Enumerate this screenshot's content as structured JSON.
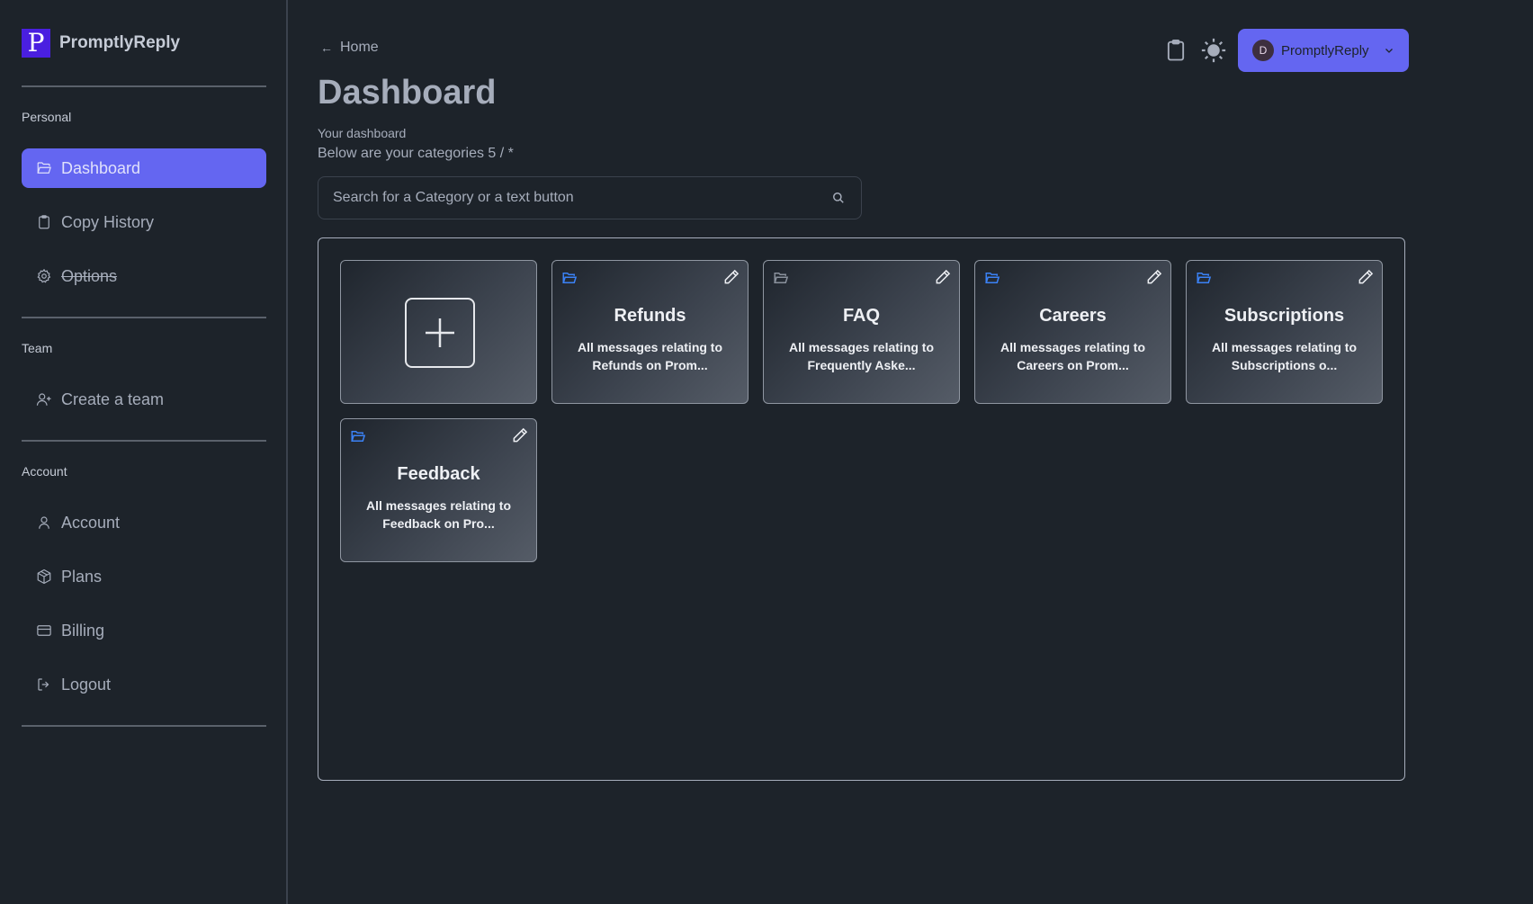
{
  "brand": {
    "logo_letter": "P",
    "name": "PromptlyReply"
  },
  "sidebar": {
    "sections": [
      {
        "label": "Personal"
      },
      {
        "label": "Team"
      },
      {
        "label": "Account"
      }
    ],
    "items": [
      {
        "label": "Dashboard",
        "icon": "folder-open-icon",
        "active": true
      },
      {
        "label": "Copy History",
        "icon": "clipboard-icon"
      },
      {
        "label": "Options",
        "icon": "gear-icon",
        "strikethrough": true
      },
      {
        "label": "Create a team",
        "icon": "user-plus-icon"
      },
      {
        "label": "Account",
        "icon": "user-icon"
      },
      {
        "label": "Plans",
        "icon": "package-icon"
      },
      {
        "label": "Billing",
        "icon": "credit-card-icon"
      },
      {
        "label": "Logout",
        "icon": "logout-icon"
      }
    ]
  },
  "header": {
    "back_label": "Home",
    "title": "Dashboard",
    "subtitle": "Your dashboard",
    "category_info": "Below are your categories 5 / *",
    "user": {
      "initial": "D",
      "name": "PromptlyReply"
    }
  },
  "search": {
    "placeholder": "Search for a Category or a text button"
  },
  "categories": [
    {
      "title": "Refunds",
      "description": "All messages relating to Refunds on Prom...",
      "folder_color": "#3b82f6"
    },
    {
      "title": "FAQ",
      "description": "All messages relating to Frequently Aske...",
      "folder_color": "#8a919c"
    },
    {
      "title": "Careers",
      "description": "All messages relating to Careers on Prom...",
      "folder_color": "#3b82f6"
    },
    {
      "title": "Subscriptions",
      "description": "All messages relating to Subscriptions o...",
      "folder_color": "#3b82f6"
    },
    {
      "title": "Feedback",
      "description": "All messages relating to Feedback on Pro...",
      "folder_color": "#3b82f6"
    }
  ],
  "colors": {
    "accent": "#6466f1",
    "background": "#1d232a",
    "brand": "#4a1fe0"
  }
}
